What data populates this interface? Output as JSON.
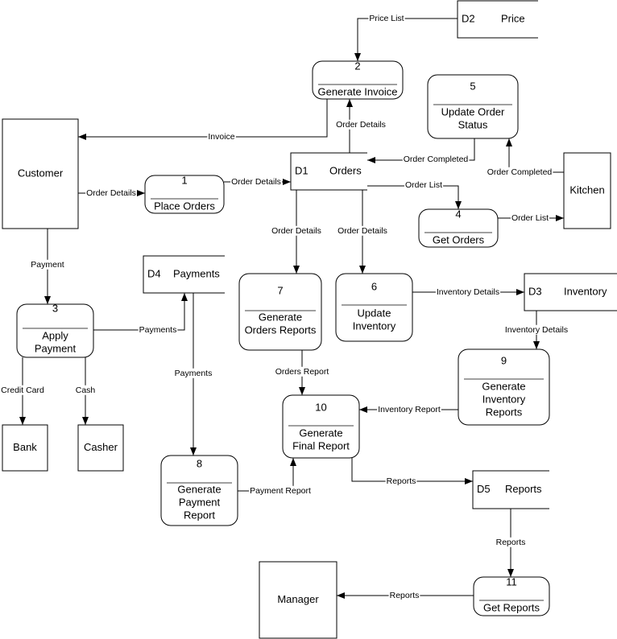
{
  "diagram": {
    "entities": [
      {
        "id": "customer",
        "label": "Customer"
      },
      {
        "id": "kitchen",
        "label": "Kitchen"
      },
      {
        "id": "bank",
        "label": "Bank"
      },
      {
        "id": "casher",
        "label": "Casher"
      },
      {
        "id": "manager",
        "label": "Manager"
      }
    ],
    "processes": [
      {
        "id": "p1",
        "number": "1",
        "lines": [
          "Place Orders"
        ]
      },
      {
        "id": "p2",
        "number": "2",
        "lines": [
          "Generate Invoice"
        ]
      },
      {
        "id": "p3",
        "number": "3",
        "lines": [
          "Apply",
          "Payment"
        ]
      },
      {
        "id": "p4",
        "number": "4",
        "lines": [
          "Get Orders"
        ]
      },
      {
        "id": "p5",
        "number": "5",
        "lines": [
          "Update Order",
          "Status"
        ]
      },
      {
        "id": "p6",
        "number": "6",
        "lines": [
          "Update",
          "Inventory"
        ]
      },
      {
        "id": "p7",
        "number": "7",
        "lines": [
          "Generate",
          "Orders Reports"
        ]
      },
      {
        "id": "p8",
        "number": "8",
        "lines": [
          "Generate",
          "Payment",
          "Report"
        ]
      },
      {
        "id": "p9",
        "number": "9",
        "lines": [
          "Generate",
          "Inventory",
          "Reports"
        ]
      },
      {
        "id": "p10",
        "number": "10",
        "lines": [
          "Generate",
          "Final Report"
        ]
      },
      {
        "id": "p11",
        "number": "11",
        "lines": [
          "Get Reports"
        ]
      }
    ],
    "stores": [
      {
        "id": "d1",
        "code": "D1",
        "label": "Orders"
      },
      {
        "id": "d2",
        "code": "D2",
        "label": "Price"
      },
      {
        "id": "d3",
        "code": "D3",
        "label": "Inventory"
      },
      {
        "id": "d4",
        "code": "D4",
        "label": "Payments"
      },
      {
        "id": "d5",
        "code": "D5",
        "label": "Reports"
      }
    ],
    "flows": [
      {
        "from": "D2 Price",
        "to": "2 Generate Invoice",
        "label": "Price List"
      },
      {
        "from": "2 Generate Invoice",
        "to": "Customer",
        "label": "Invoice"
      },
      {
        "from": "D1 Orders",
        "to": "2 Generate Invoice",
        "label": "Order Details"
      },
      {
        "from": "5 Update Order Status",
        "to": "D1 Orders",
        "label": "Order Completed"
      },
      {
        "from": "Kitchen",
        "to": "5 Update Order Status",
        "label": "Order Completed"
      },
      {
        "from": "Customer",
        "to": "1 Place Orders",
        "label": "Order Details"
      },
      {
        "from": "1 Place Orders",
        "to": "D1 Orders",
        "label": "Order Details"
      },
      {
        "from": "D1 Orders",
        "to": "4 Get Orders",
        "label": "Order List"
      },
      {
        "from": "4 Get Orders",
        "to": "Kitchen",
        "label": "Order List"
      },
      {
        "from": "D1 Orders",
        "to": "7 Generate Orders Reports",
        "label": "Order Details"
      },
      {
        "from": "D1 Orders",
        "to": "6 Update Inventory",
        "label": "Order Details"
      },
      {
        "from": "6 Update Inventory",
        "to": "D3 Inventory",
        "label": "Inventory Details"
      },
      {
        "from": "D3 Inventory",
        "to": "9 Generate Inventory Reports",
        "label": "Inventory Details"
      },
      {
        "from": "Customer",
        "to": "3 Apply Payment",
        "label": "Payment"
      },
      {
        "from": "3 Apply Payment",
        "to": "D4 Payments",
        "label": "Payments"
      },
      {
        "from": "D4 Payments",
        "to": "8 Generate Payment Report",
        "label": "Payments"
      },
      {
        "from": "3 Apply Payment",
        "to": "Bank",
        "label": "Credit Card"
      },
      {
        "from": "3 Apply Payment",
        "to": "Casher",
        "label": "Cash"
      },
      {
        "from": "7 Generate Orders Reports",
        "to": "10 Generate Final Report",
        "label": "Orders Report"
      },
      {
        "from": "9 Generate Inventory Reports",
        "to": "10 Generate Final Report",
        "label": "Inventory Report"
      },
      {
        "from": "8 Generate Payment Report",
        "to": "10 Generate Final Report",
        "label": "Payment Report"
      },
      {
        "from": "10 Generate Final Report",
        "to": "D5 Reports",
        "label": "Reports"
      },
      {
        "from": "D5 Reports",
        "to": "11 Get Reports",
        "label": "Reports"
      },
      {
        "from": "11 Get Reports",
        "to": "Manager",
        "label": "Reports"
      }
    ]
  }
}
